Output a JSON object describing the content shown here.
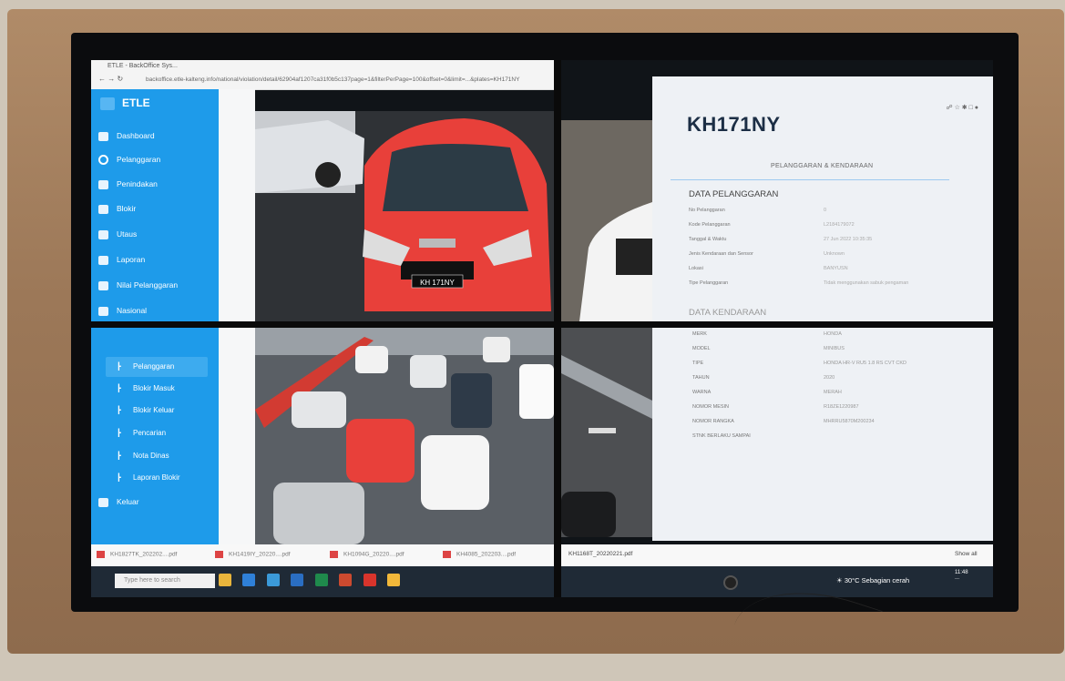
{
  "browser": {
    "tab_title": "ETLE - BackOffice Sys...",
    "url": "backoffice.etle-kalteng.info/national/violation/detail/62904af1207ca31f0b5c137page=1&filterPerPage=100&offset=0&limit=...&plates=KH171NY"
  },
  "sidebar": {
    "brand": "ETLE",
    "items": [
      {
        "label": "Dashboard"
      },
      {
        "label": "Pelanggaran"
      },
      {
        "label": "Penindakan"
      },
      {
        "label": "Blokir"
      },
      {
        "label": "Utaus"
      },
      {
        "label": "Laporan"
      },
      {
        "label": "Nilai Pelanggaran"
      },
      {
        "label": "Nasional"
      }
    ],
    "subitems": [
      {
        "label": "Pelanggaran"
      },
      {
        "label": "Blokir Masuk"
      },
      {
        "label": "Blokir Keluar"
      },
      {
        "label": "Pencarian"
      },
      {
        "label": "Nota Dinas"
      },
      {
        "label": "Laporan Blokir"
      }
    ],
    "logout": "Keluar"
  },
  "photos": {
    "plate_top": "KH 171NY"
  },
  "detail": {
    "plate": "KH171NY",
    "tab": "PELANGGARAN & KENDARAAN",
    "pelanggaran_heading": "DATA PELANGGARAN",
    "pelanggaran_rows": [
      {
        "label": "No Pelanggaran",
        "value": "0"
      },
      {
        "label": "Kode Pelanggaran",
        "value": "L2184179072"
      },
      {
        "label": "Tanggal & Waktu",
        "value": "27 Jun 2022 10:35:35"
      },
      {
        "label": "Jenis Kendaraan dan Sensor",
        "value": "Unknown"
      },
      {
        "label": "Lokasi",
        "value": "BANYUSN"
      },
      {
        "label": "Tipe Pelanggaran",
        "value": "Tidak menggunakan sabuk pengaman"
      }
    ],
    "kendaraan_heading": "DATA KENDARAAN",
    "kendaraan_rows": [
      {
        "label": "MERK",
        "value": "HONDA"
      },
      {
        "label": "MODEL",
        "value": "MINIBUS"
      },
      {
        "label": "TIPE",
        "value": "HONDA HR-V RU5 1.8 RS CVT CKD"
      },
      {
        "label": "TAHUN",
        "value": "2020"
      },
      {
        "label": "WARNA",
        "value": "MERAH"
      },
      {
        "label": "NOMOR MESIN",
        "value": "R18ZE1220987"
      },
      {
        "label": "NOMOR RANGKA",
        "value": "MHRRU5870M200234"
      },
      {
        "label": "STNK BERLAKU SAMPAI",
        "value": ""
      }
    ]
  },
  "downloads": {
    "items": [
      "KH1827TK_202202....pdf",
      "KH1419IY_20220....pdf",
      "KH1094G_20220....pdf",
      "KH4085_202203....pdf",
      "KH1168T_20220221.pdf"
    ],
    "show_all": "Show all"
  },
  "taskbar": {
    "search_placeholder": "Type here to search",
    "weather": "30°C Sebagian cerah",
    "time": "11:48",
    "date": "..."
  },
  "colors": {
    "sidebar_blue": "#1e9bea",
    "frame_wood": "#9c7858",
    "car_red": "#e8403a"
  }
}
